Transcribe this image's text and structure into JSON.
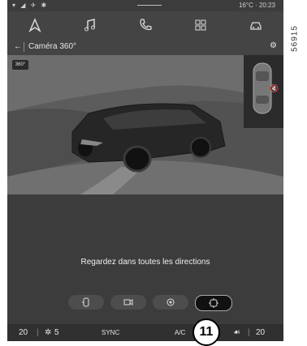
{
  "statusbar": {
    "left_icons": "▾ ◢ ✈ ✱",
    "temp_time": "16°C · 20:23"
  },
  "navbar": {
    "items": [
      "navigation-icon",
      "music-icon",
      "phone-icon",
      "apps-icon",
      "vehicle-icon"
    ]
  },
  "titlebar": {
    "back": "←",
    "title": "Caméra 360°",
    "settings": "⚙"
  },
  "camera": {
    "mode_badge": "360°"
  },
  "message": "Regardez dans toutes les directions",
  "camera_modes": [
    "front-rear-camera-icon",
    "camera-icon",
    "360-view-icon",
    "all-directions-icon"
  ],
  "climate": {
    "left_temp": "20",
    "fan": "5",
    "sync": "SYNC",
    "ac": "A/C",
    "right_temp": "20"
  },
  "callout": "11",
  "figure_code": "56915"
}
